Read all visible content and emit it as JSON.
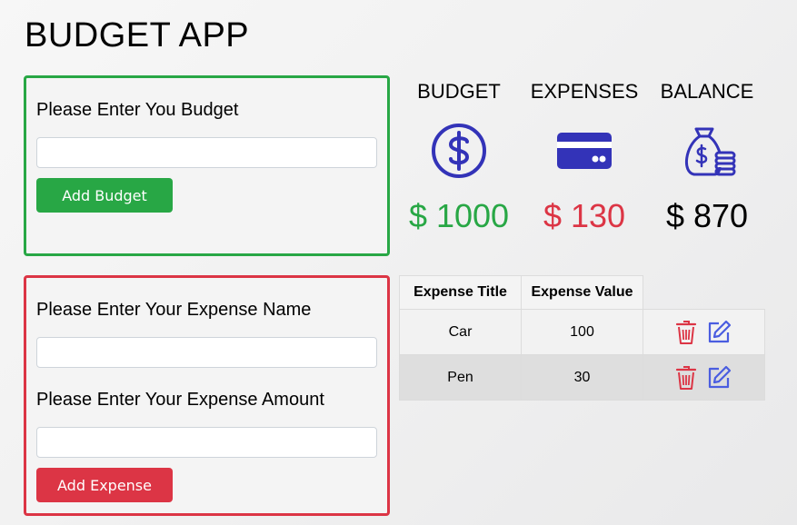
{
  "app": {
    "title": "BUDGET APP"
  },
  "budget_form": {
    "label": "Please Enter You Budget",
    "input_value": "",
    "button_label": "Add Budget"
  },
  "expense_form": {
    "name_label": "Please Enter Your Expense Name",
    "name_value": "",
    "amount_label": "Please Enter Your Expense Amount",
    "amount_value": "",
    "button_label": "Add Expense"
  },
  "stats": {
    "budget": {
      "label": "BUDGET",
      "value": "$ 1000",
      "icon": "dollar-circle-icon",
      "color": "#28a745"
    },
    "expenses": {
      "label": "EXPENSES",
      "value": "$ 130",
      "icon": "credit-card-icon",
      "color": "#dc3545"
    },
    "balance": {
      "label": "BALANCE",
      "value": "$ 870",
      "icon": "money-bag-icon",
      "color": "#000000"
    },
    "icon_color": "#3333b8"
  },
  "table": {
    "headers": [
      "Expense Title",
      "Expense Value"
    ],
    "rows": [
      {
        "title": "Car",
        "value": "100"
      },
      {
        "title": "Pen",
        "value": "30"
      }
    ],
    "icons": {
      "delete": "trash-icon",
      "edit": "edit-icon"
    },
    "delete_color": "#dc3545",
    "edit_color": "#4a5de0"
  }
}
